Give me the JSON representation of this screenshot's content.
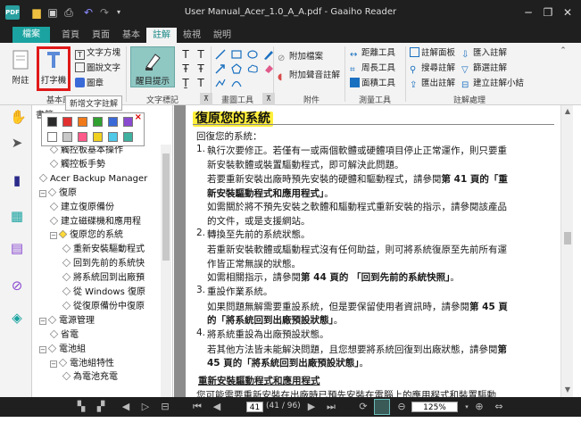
{
  "titlebar": {
    "app_icon_text": "PDF",
    "title": "User Manual_Acer_1.0_A_A.pdf - Gaaiho Reader",
    "quick_access": [
      "folder-icon",
      "save-icon",
      "print-icon",
      "undo-icon",
      "redo-icon",
      "dropdown-icon"
    ],
    "controls": [
      "minimize-icon",
      "restore-icon",
      "close-icon"
    ]
  },
  "tabs": [
    {
      "label": "檔案"
    },
    {
      "label": "首頁"
    },
    {
      "label": "頁面"
    },
    {
      "label": "基本"
    },
    {
      "label": "註解"
    },
    {
      "label": "檢視"
    },
    {
      "label": "說明"
    }
  ],
  "ribbon": {
    "attach_label": "附註",
    "typewriter_label": "打字機",
    "textbox_label": "文字方塊",
    "callout_label": "圖說文字",
    "stamp_label": "圖章",
    "basic_group_label": "基本註",
    "highlight_label": "醒目提示",
    "text_mark_group_label": "文字標記",
    "drawing_group_label": "畫圖工具",
    "attach_file_label": "附加檔案",
    "attach_audio_label": "附加聲音註解",
    "attach_group_label": "附件",
    "distance_label": "距離工具",
    "perimeter_label": "周長工具",
    "area_label": "面積工具",
    "measure_group_label": "測量工具",
    "comment_panel_label": "註解面板",
    "import_label": "匯入註解",
    "search_label": "搜尋註解",
    "filter_label": "篩選註解",
    "export_label": "匯出註解",
    "summary_label": "建立註解小結",
    "comment_group_label": "註解處理"
  },
  "tooltip": "新增文字註解",
  "bookmarks": {
    "title": "書籤",
    "items": [
      {
        "label": "觸控板基本操作",
        "indent": 1,
        "expander": ""
      },
      {
        "label": "觸控板手勢",
        "indent": 1,
        "expander": ""
      },
      {
        "label": "Acer Backup Manager",
        "indent": 0,
        "expander": ""
      },
      {
        "label": "復原",
        "indent": 0,
        "expander": "−"
      },
      {
        "label": "建立復原備份",
        "indent": 1,
        "expander": ""
      },
      {
        "label": "建立磁碟機和應用程",
        "indent": 1,
        "expander": ""
      },
      {
        "label": "復原您的系統",
        "indent": 1,
        "expander": "−"
      },
      {
        "label": "重新安裝驅動程式",
        "indent": 2,
        "expander": ""
      },
      {
        "label": "回到先前的系統快",
        "indent": 2,
        "expander": ""
      },
      {
        "label": "將系統回到出廠預",
        "indent": 2,
        "expander": ""
      },
      {
        "label": "從 Windows 復原",
        "indent": 2,
        "expander": ""
      },
      {
        "label": "從復原備份中復原",
        "indent": 2,
        "expander": ""
      },
      {
        "label": "電源管理",
        "indent": 0,
        "expander": "−"
      },
      {
        "label": "省電",
        "indent": 1,
        "expander": ""
      },
      {
        "label": "電池組",
        "indent": 0,
        "expander": "−"
      },
      {
        "label": "電池組特性",
        "indent": 1,
        "expander": "−"
      },
      {
        "label": "為電池充電",
        "indent": 2,
        "expander": ""
      }
    ]
  },
  "palette": {
    "row1": [
      "#2b2b2b",
      "#e23030",
      "#f07a1a",
      "#30a030",
      "#3a6ad8",
      "#8a4ad0"
    ],
    "row2": [
      "#ffffff",
      "#c8c8c8",
      "#ff5a8a",
      "#f0d020",
      "#50c8e8",
      "#40b0a0"
    ],
    "close": "×"
  },
  "document": {
    "heading": "復原您的系統",
    "lines": [
      {
        "type": "p",
        "text": "回復您的系統："
      },
      {
        "type": "num",
        "n": "1.",
        "text": "執行次要修正。若僅有一或兩個軟體或硬體項目停止正常運作，則只要重"
      },
      {
        "type": "p2",
        "text": "新安裝軟體或裝置驅動程式，即可解決此問題。"
      },
      {
        "type": "p2",
        "text": "若要重新安裝出廠時預先安裝的硬體和驅動程式，請參閱",
        "bold": "第 41 頁的「重"
      },
      {
        "type": "p2b",
        "text": "新安裝驅動程式和應用程式」",
        "tail": "。"
      },
      {
        "type": "p2",
        "text": "如需關於將不預先安裝之軟體和驅動程式重新安裝的指示，請參閱該產品"
      },
      {
        "type": "p2",
        "text": "的文件，或是支援網站。"
      },
      {
        "type": "num",
        "n": "2.",
        "text": "轉換至先前的系統狀態。"
      },
      {
        "type": "p2",
        "text": "若重新安裝軟體或驅動程式沒有任何助益，則可將系統復原至先前所有運"
      },
      {
        "type": "p2",
        "text": "作皆正常無誤的狀態。"
      },
      {
        "type": "p2",
        "text": "如需相關指示，請參閱",
        "bold": "第 44 頁的 「回到先前的系統快照」",
        "tail": "。"
      },
      {
        "type": "num",
        "n": "3.",
        "text": "重設作業系統。"
      },
      {
        "type": "p2",
        "text": "如果問題無解需要重設系統，但是要保留使用者資訊時，請參閱",
        "bold": "第 45 頁"
      },
      {
        "type": "p2b",
        "text": "的「將系統回到出廠預設狀態」",
        "tail": "。"
      },
      {
        "type": "num",
        "n": "4.",
        "text": "將系統重設為出廠預設狀態。"
      },
      {
        "type": "p2",
        "text": "若其他方法皆未能解決問題，且您想要將系統回復到出廠狀態，請參閱",
        "bold": "第"
      },
      {
        "type": "p2b",
        "text": "45 頁的「將系統回到出廠預設狀態」",
        "tail": "。"
      },
      {
        "type": "sub",
        "text": "重新安裝驅動程式和應用程式"
      },
      {
        "type": "p",
        "text": "您可能需要重新安裝在出廠時已預先安裝在電腦上的應用程式和裝置驅動"
      }
    ]
  },
  "statusbar": {
    "page": "41",
    "page_count": "(41 / 96)",
    "zoom": "125%"
  }
}
